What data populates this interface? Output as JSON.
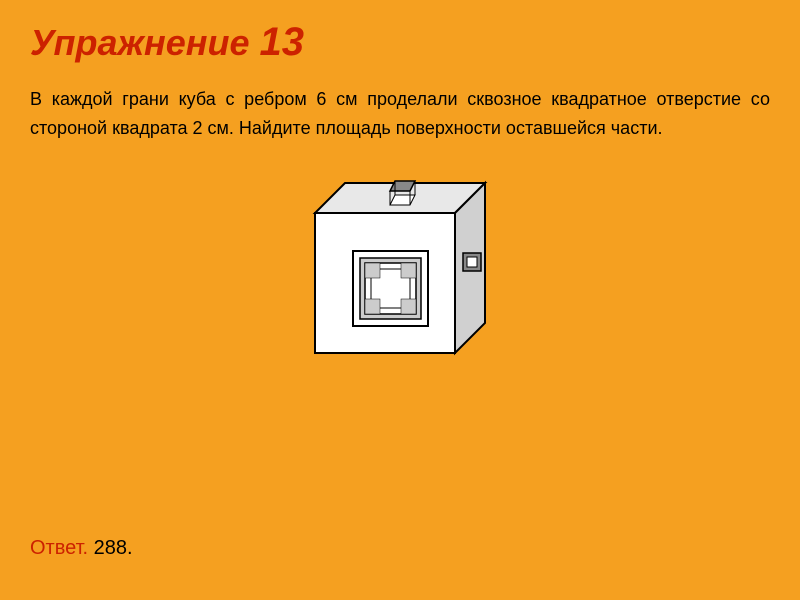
{
  "title": {
    "prefix": "Упражнение",
    "number": "13"
  },
  "problem": {
    "text": "В каждой грани куба с ребром 6 см проделали сквозное квадратное отверстие со стороной квадрата 2 см. Найдите площадь поверхности оставшейся части."
  },
  "answer": {
    "label": "Ответ.",
    "value": " 288."
  },
  "colors": {
    "background": "#F5A020",
    "title": "#CC2200",
    "text": "#000000"
  }
}
